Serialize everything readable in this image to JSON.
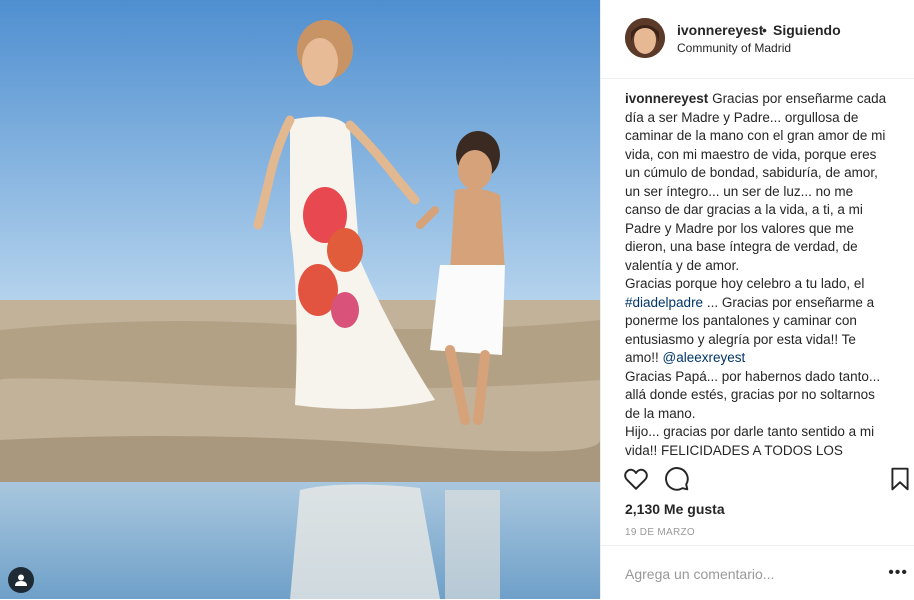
{
  "header": {
    "username": "ivonnereyest",
    "separator": "•",
    "follow_status": "Siguiendo",
    "location": "Community of Madrid"
  },
  "caption": {
    "username": "ivonnereyest",
    "p1": "Gracias por enseñarme cada día a ser Madre y Padre... orgullosa de caminar de la mano con el gran amor de mi vida, con mi maestro de vida, porque eres un cúmulo de bondad, sabiduría, de amor, un ser íntegro... un ser de luz... no me canso de dar gracias a la vida, a ti, a mi Padre y Madre por los valores que me dieron, una base íntegra de verdad, de valentía y de amor.",
    "p2_before": "Gracias porque hoy celebro a tu lado, el ",
    "hashtag": "#diadelpadre",
    "p2_after": " ... Gracias por enseñarme a ponerme los pantalones y caminar con entusiasmo y alegría por esta vida!! Te amo!! ",
    "mention": "@aleexreyest",
    "p3": "Gracias Papá... por habernos dado tanto... allá donde estés, gracias por no soltarnos de la mano.",
    "p4": "Hijo... gracias por darle tanto sentido a mi vida!! FELICIDADES A TODOS LOS PADRES Y MADRES QUE EJERCEMOS LOS DOS"
  },
  "likes": "2,130 Me gusta",
  "date": "19 DE MARZO",
  "comment_placeholder": "Agrega un comentario...",
  "more_label": "•••",
  "icons": {
    "like": "heart-icon",
    "comment": "comment-icon",
    "save": "bookmark-icon",
    "tagged": "user-tag-icon"
  }
}
